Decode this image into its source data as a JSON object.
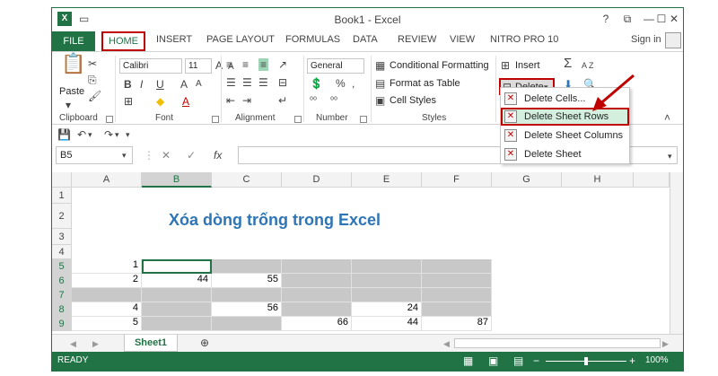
{
  "window": {
    "title": "Book1 - Excel",
    "help": "?",
    "restore": "⧉",
    "minimize": "—",
    "maximize": "☐",
    "close": "✕",
    "logo": "X"
  },
  "tabs": [
    "FILE",
    "HOME",
    "INSERT",
    "PAGE LAYOUT",
    "FORMULAS",
    "DATA",
    "REVIEW",
    "VIEW",
    "NITRO PRO 10"
  ],
  "signin": "Sign in",
  "ribbon": {
    "clipboard": {
      "label": "Clipboard",
      "paste": "Paste"
    },
    "font": {
      "label": "Font",
      "name": "Calibri",
      "size": "11",
      "bold": "B",
      "italic": "I",
      "underline": "U",
      "grow": "A",
      "shrink": "A"
    },
    "alignment": {
      "label": "Alignment"
    },
    "number": {
      "label": "Number",
      "format": "General",
      "percent": "%",
      "comma": ","
    },
    "styles": {
      "label": "Styles",
      "conditional": "Conditional Formatting",
      "table": "Format as Table",
      "cellstyles": "Cell Styles"
    },
    "cells": {
      "insert": "Insert",
      "delete": "Delete"
    },
    "editing": {
      "sum": "Σ",
      "sort": "A Z"
    }
  },
  "delete_menu": [
    {
      "label": "Delete Cells...",
      "highlight": false
    },
    {
      "label": "Delete Sheet Rows",
      "highlight": true
    },
    {
      "label": "Delete Sheet Columns",
      "highlight": false
    },
    {
      "label": "Delete Sheet",
      "highlight": false
    }
  ],
  "formula_bar": {
    "namebox": "B5",
    "fx": "fx",
    "cancel": "✕",
    "enter": "✓"
  },
  "columns": [
    "A",
    "B",
    "C",
    "D",
    "E",
    "F",
    "G",
    "H"
  ],
  "rows": [
    "1",
    "2",
    "3",
    "4",
    "5",
    "6",
    "7",
    "8",
    "9"
  ],
  "headline": "Xóa dòng trống trong Excel",
  "cells": {
    "A5": "1",
    "A6": "2",
    "B6": "44",
    "C6": "55",
    "A8": "4",
    "C8": "56",
    "E8": "24",
    "A9": "5",
    "D9": "66",
    "E9": "44",
    "F9": "87"
  },
  "sheet_tab": "Sheet1",
  "status": {
    "ready": "READY",
    "zoom": "100%"
  }
}
